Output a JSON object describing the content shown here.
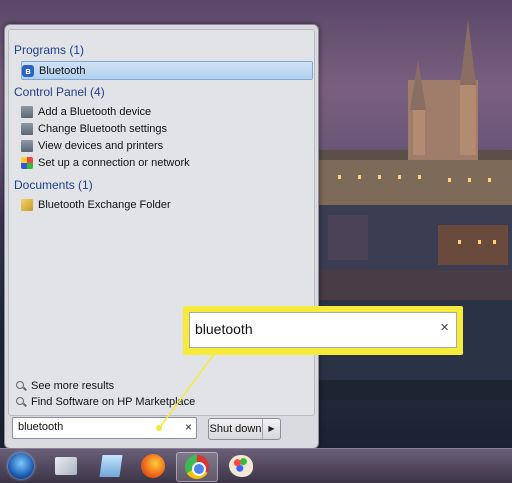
{
  "start_menu": {
    "programs": {
      "header": "Programs (1)",
      "items": [
        {
          "label": "Bluetooth",
          "icon": "bluetooth-icon"
        }
      ]
    },
    "control_panel": {
      "header": "Control Panel (4)",
      "items": [
        {
          "label": "Add a Bluetooth device",
          "icon": "device-icon"
        },
        {
          "label": "Change Bluetooth settings",
          "icon": "device-icon"
        },
        {
          "label": "View devices and printers",
          "icon": "device-icon"
        },
        {
          "label": "Set up a connection or network",
          "icon": "network-icon"
        }
      ]
    },
    "documents": {
      "header": "Documents (1)",
      "items": [
        {
          "label": "Bluetooth Exchange Folder",
          "icon": "folder-icon"
        }
      ]
    },
    "see_more": "See more results",
    "find_software": "Find Software on HP Marketplace",
    "search": {
      "value": "bluetooth",
      "clear": "×"
    },
    "shutdown": {
      "label": "Shut down",
      "arrow": "▶"
    }
  },
  "callout": {
    "value": "bluetooth",
    "clear": "×",
    "color": "#f6ea3b"
  },
  "taskbar": {
    "items": [
      {
        "icon": "windows-start-orb-icon"
      },
      {
        "icon": "snipping-tool-icon"
      },
      {
        "icon": "sticky-notes-icon"
      },
      {
        "icon": "firefox-icon"
      },
      {
        "icon": "chrome-icon",
        "active": true
      },
      {
        "icon": "paint-icon"
      }
    ]
  }
}
